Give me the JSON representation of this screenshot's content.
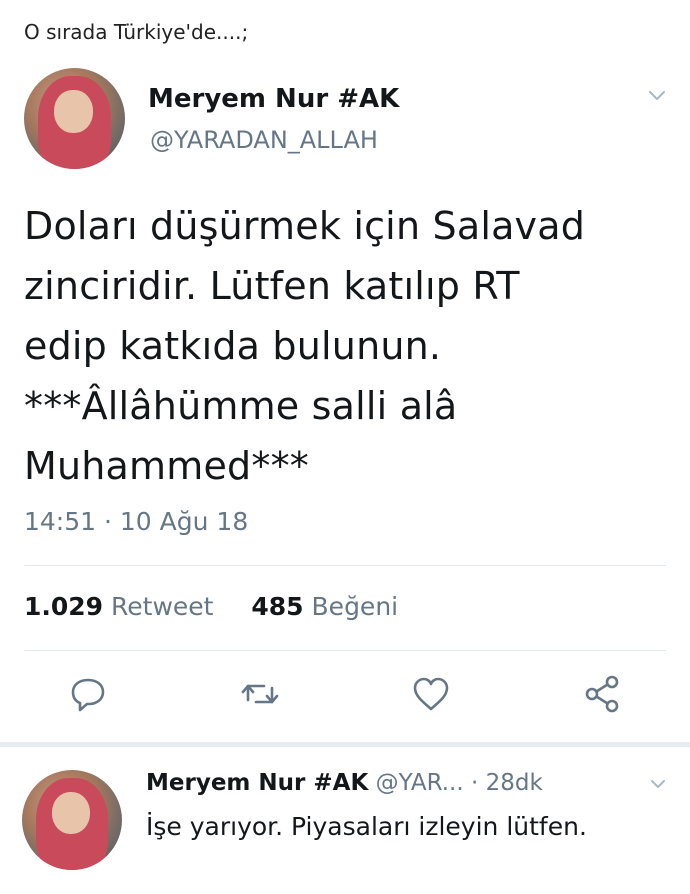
{
  "caption": "O sırada Türkiye'de....;",
  "tweet": {
    "name": "Meryem Nur #AK",
    "handle": "@YARADAN_ALLAH",
    "lines": [
      "Doları düşürmek için Salavad",
      "zinciridir.  Lütfen katılıp RT",
      "edip katkıda bulunun.",
      "***Âllâhümme salli alâ",
      "Muhammed***"
    ],
    "time": "14:51 · 10 Ağu 18",
    "retweet_count": "1.029",
    "retweet_label": "Retweet",
    "like_count": "485",
    "like_label": "Beğeni"
  },
  "icons": {
    "reply": "reply-icon",
    "retweet": "retweet-icon",
    "like": "heart-icon",
    "share": "share-icon",
    "more": "chevron-down-icon"
  },
  "colors": {
    "secondary": "#657786",
    "icon": "#657786",
    "text": "#14171a"
  },
  "reply": {
    "name": "Meryem Nur #AK",
    "handle": "@YAR...",
    "time": "· 28dk",
    "text": "İşe yarıyor. Piyasaları izleyin lütfen."
  }
}
